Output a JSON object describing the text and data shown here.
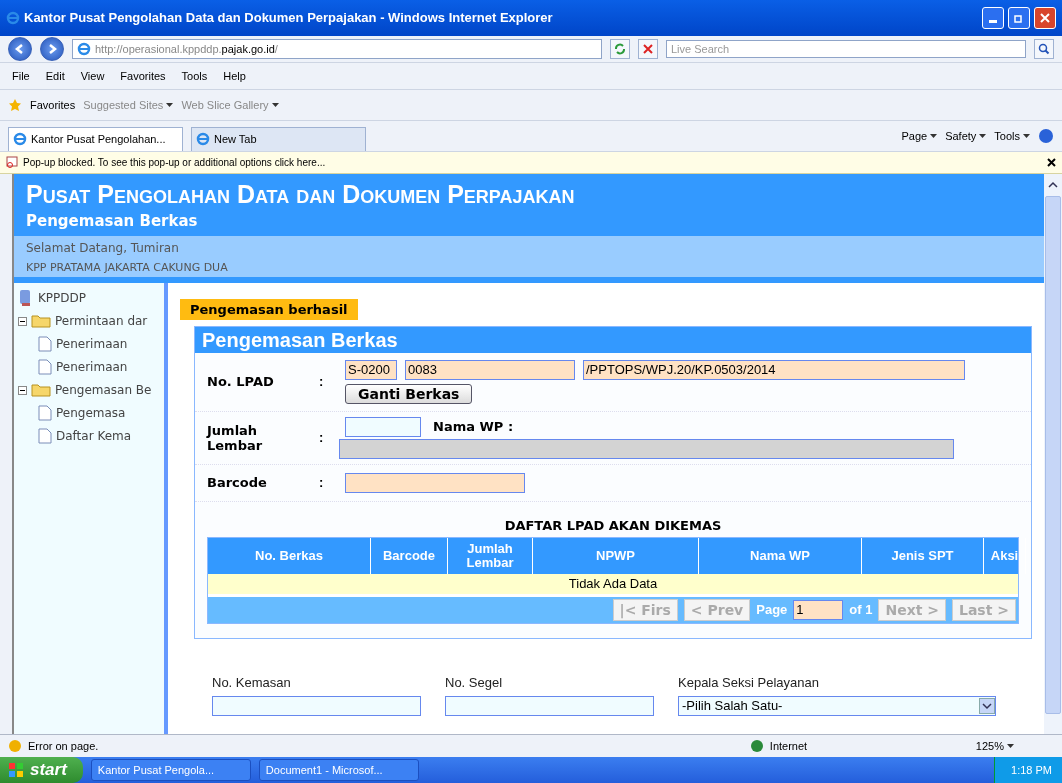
{
  "browser": {
    "title": "Kantor Pusat Pengolahan Data dan Dokumen Perpajakan - Windows Internet Explorer",
    "address": {
      "prefix": "http://operasional.kppddp.",
      "host": "pajak.go.id",
      "suffix": "/"
    },
    "search": {
      "placeholder": "Live Search"
    },
    "menu": [
      "File",
      "Edit",
      "View",
      "Favorites",
      "Tools",
      "Help"
    ],
    "favorites": {
      "label": "Favorites",
      "links": [
        "Suggested Sites",
        "Web Slice Gallery"
      ]
    },
    "tabs": [
      {
        "label": "Kantor Pusat Pengolahan...",
        "selected": true
      },
      {
        "label": "New Tab",
        "selected": false
      }
    ],
    "commands": [
      "Page",
      "Safety",
      "Tools"
    ],
    "popup": "Pop-up blocked. To see this pop-up or additional options click here..."
  },
  "page": {
    "title": "Pusat Pengolahan Data dan Dokumen Perpajakan",
    "subtitle": "Pengemasan Berkas",
    "welcome": "Selamat Datang, Tumiran",
    "office": "KPP PRATAMA JAKARTA CAKUNG DUA",
    "tree": [
      {
        "label": "KPPDDP",
        "kind": "root",
        "children": [
          {
            "label": "Permintaan dar",
            "kind": "folder",
            "expanded": true,
            "children": [
              {
                "label": "Penerimaan",
                "kind": "page"
              },
              {
                "label": "Penerimaan",
                "kind": "page"
              }
            ]
          },
          {
            "label": "Pengemasan Be",
            "kind": "folder",
            "expanded": true,
            "children": [
              {
                "label": "Pengemasa",
                "kind": "page"
              },
              {
                "label": "Daftar Kema",
                "kind": "page"
              }
            ]
          }
        ]
      }
    ],
    "alert": "Pengemasan berhasil",
    "form": {
      "title": "Pengemasan Berkas",
      "lpad_label": "No. LPAD",
      "colon": ":",
      "lpad_values": [
        "S-0200",
        "0083",
        "/PPTOPS/WPJ.20/KP.0503/2014"
      ],
      "change_button": "Ganti Berkas",
      "sheets_label": "Jumlah Lembar",
      "nama_label": "Nama WP :",
      "barcode_label": "Barcode",
      "table": {
        "title": "DAFTAR LPAD AKAN DIKEMAS",
        "columns": [
          "No. Berkas",
          "Barcode",
          "Jumlah Lembar",
          "NPWP",
          "Nama WP",
          "Jenis SPT",
          "Aksi"
        ],
        "empty": "Tidak Ada Data",
        "pager": {
          "first": "|< Firs",
          "prev": "< Prev",
          "page_label": "Page",
          "page": "1",
          "of": "of 1",
          "next": "Next >",
          "last": "Last >",
          "disabled": true
        }
      }
    },
    "bottom": {
      "fields": [
        {
          "label": "No. Kemasan"
        },
        {
          "label": "No. Segel"
        }
      ],
      "select_label": "Kepala Seksi Pelayanan",
      "select_value": "-Pilih Salah Satu-"
    }
  },
  "status": {
    "text": "Error on page.",
    "zone": "Internet",
    "zoom": "125%"
  },
  "taskbar": {
    "start": "start",
    "items": [
      "Kantor Pusat Pengola...",
      "Document1 - Microsof..."
    ],
    "clock": "1:18 PM"
  }
}
